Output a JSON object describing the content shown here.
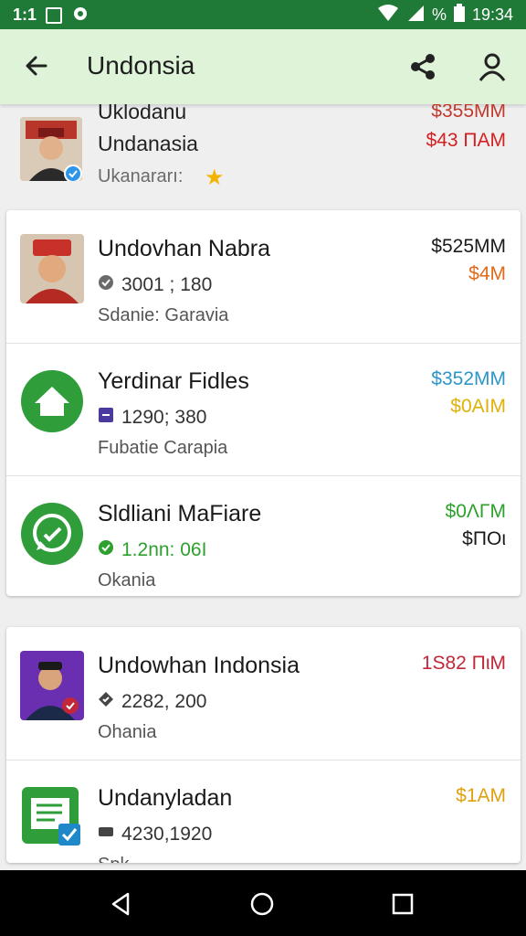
{
  "status_bar": {
    "left_text": "1:1",
    "time": "19:34",
    "battery": "%"
  },
  "app_bar": {
    "title": "Undonsia"
  },
  "top_item": {
    "name_line1": "Uklodanu",
    "name_line2": "Undanasia",
    "subtitle": "Ukanararı:",
    "price_1": "$355MM",
    "price_2": "$43 ПАМ"
  },
  "items": [
    {
      "title": "Undovhan Nabra",
      "meta": "3001 ; 180",
      "location": "Sdanie: Garavia",
      "price_1": "$525MM",
      "price_2": "$4M",
      "price_1_color": "#1a1a1a",
      "price_2_color": "#e06a1a",
      "meta_icon_color": "#6a6a6a",
      "icon": "person-avatar"
    },
    {
      "title": "Yerdinar Fidles",
      "meta": "1290; 380",
      "location": "Fubatie Carapia",
      "price_1": "$352MM",
      "price_2": "$0AIM",
      "price_1_color": "#2e97c8",
      "price_2_color": "#e0b10a",
      "meta_icon_color": "#4a3aa0",
      "icon": "home-icon"
    },
    {
      "title": "Sldliani MaFiare",
      "meta": "1.2nn: 06I",
      "location": "Okania",
      "price_1": "$0ΛΓM",
      "price_2": "$ΠΟι",
      "price_1_color": "#2ea02e",
      "price_2_color": "#1a1a1a",
      "meta_icon_color": "#2ea02e",
      "icon": "whatsapp-icon"
    },
    {
      "title": "Undowhan Indonsia",
      "meta": "2282, 200",
      "location": "Ohania",
      "price_1": "1S82 ΠιM",
      "price_2": "",
      "price_1_color": "#c0283a",
      "price_2_color": "#c0283a",
      "meta_icon_color": "#444444",
      "icon": "person-avatar"
    },
    {
      "title": "Undanyladan",
      "meta": "4230,1920",
      "location": "Spk",
      "price_1": "$1AM",
      "price_2": "",
      "price_1_color": "#e0a010",
      "price_2_color": "#e0a010",
      "meta_icon_color": "#444444",
      "icon": "document-icon"
    }
  ],
  "colors": {
    "status_bar": "#1f7a37",
    "app_bar": "#dff3d8",
    "green_icon": "#2e9d3a"
  }
}
